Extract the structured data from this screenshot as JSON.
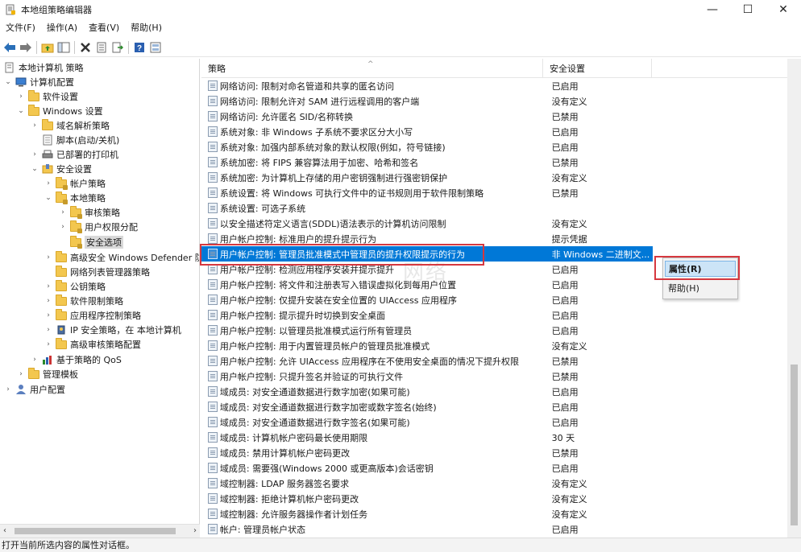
{
  "window": {
    "title": "本地组策略编辑器",
    "app_icon": "policy-editor-icon",
    "minimize": "—",
    "maximize": "☐",
    "close": "✕"
  },
  "menu": [
    "文件(F)",
    "操作(A)",
    "查看(V)",
    "帮助(H)"
  ],
  "toolbar": [
    "back-arrow-icon",
    "forward-arrow-icon",
    "up-folder-icon",
    "show-tree-icon",
    "delete-icon",
    "properties-icon",
    "export-icon",
    "help-icon",
    "view-icon"
  ],
  "tree": [
    {
      "label": "本地计算机 策略",
      "level": 0,
      "chev": "",
      "icon": "computer-policy-icon"
    },
    {
      "label": "计算机配置",
      "level": 1,
      "chev": "v",
      "icon": "computer-icon"
    },
    {
      "label": "软件设置",
      "level": 2,
      "chev": ">",
      "icon": "folder-icon"
    },
    {
      "label": "Windows 设置",
      "level": 2,
      "chev": "v",
      "icon": "folder-icon"
    },
    {
      "label": "域名解析策略",
      "level": 3,
      "chev": ">",
      "icon": "folder-icon"
    },
    {
      "label": "脚本(启动/关机)",
      "level": 3,
      "chev": "",
      "icon": "script-icon"
    },
    {
      "label": "已部署的打印机",
      "level": 3,
      "chev": ">",
      "icon": "printer-icon"
    },
    {
      "label": "安全设置",
      "level": 3,
      "chev": "v",
      "icon": "security-icon"
    },
    {
      "label": "帐户策略",
      "level": 4,
      "chev": ">",
      "icon": "lock-folder-icon"
    },
    {
      "label": "本地策略",
      "level": 4,
      "chev": "v",
      "icon": "lock-folder-icon"
    },
    {
      "label": "审核策略",
      "level": 5,
      "chev": ">",
      "icon": "lock-folder-icon"
    },
    {
      "label": "用户权限分配",
      "level": 5,
      "chev": ">",
      "icon": "lock-folder-icon"
    },
    {
      "label": "安全选项",
      "level": 5,
      "chev": "",
      "icon": "lock-folder-icon",
      "selected": true
    },
    {
      "label": "高级安全 Windows Defender 防",
      "level": 4,
      "chev": ">",
      "icon": "folder-icon"
    },
    {
      "label": "网络列表管理器策略",
      "level": 4,
      "chev": "",
      "icon": "folder-icon"
    },
    {
      "label": "公钥策略",
      "level": 4,
      "chev": ">",
      "icon": "folder-icon"
    },
    {
      "label": "软件限制策略",
      "level": 4,
      "chev": ">",
      "icon": "folder-icon"
    },
    {
      "label": "应用程序控制策略",
      "level": 4,
      "chev": ">",
      "icon": "folder-icon"
    },
    {
      "label": "IP 安全策略，在 本地计算机",
      "level": 4,
      "chev": ">",
      "icon": "ip-security-icon"
    },
    {
      "label": "高级审核策略配置",
      "level": 4,
      "chev": ">",
      "icon": "folder-icon"
    },
    {
      "label": "基于策略的 QoS",
      "level": 3,
      "chev": ">",
      "icon": "chart-icon"
    },
    {
      "label": "管理模板",
      "level": 2,
      "chev": ">",
      "icon": "folder-icon"
    },
    {
      "label": "用户配置",
      "level": 1,
      "chev": ">",
      "icon": "user-icon"
    }
  ],
  "list": {
    "col_policy": "策略",
    "col_setting": "安全设置",
    "rows": [
      {
        "name": "网络访问: 限制对命名管道和共享的匿名访问",
        "setting": "已启用"
      },
      {
        "name": "网络访问: 限制允许对 SAM 进行远程调用的客户端",
        "setting": "没有定义"
      },
      {
        "name": "网络访问: 允许匿名 SID/名称转换",
        "setting": "已禁用"
      },
      {
        "name": "系统对象: 非 Windows 子系统不要求区分大小写",
        "setting": "已启用"
      },
      {
        "name": "系统对象: 加强内部系统对象的默认权限(例如，符号链接)",
        "setting": "已启用"
      },
      {
        "name": "系统加密: 将 FIPS 兼容算法用于加密、哈希和签名",
        "setting": "已禁用"
      },
      {
        "name": "系统加密: 为计算机上存储的用户密钥强制进行强密钥保护",
        "setting": "没有定义"
      },
      {
        "name": "系统设置: 将 Windows 可执行文件中的证书规则用于软件限制策略",
        "setting": "已禁用"
      },
      {
        "name": "系统设置: 可选子系统",
        "setting": ""
      },
      {
        "name": "以安全描述符定义语言(SDDL)语法表示的计算机访问限制",
        "setting": "没有定义"
      },
      {
        "name": "用户帐户控制: 标准用户的提升提示行为",
        "setting": "提示凭据"
      },
      {
        "name": "用户帐户控制: 管理员批准模式中管理员的提升权限提示的行为",
        "setting": "非 Windows 二进制文...",
        "selected": true
      },
      {
        "name": "用户帐户控制: 检测应用程序安装并提示提升",
        "setting": "已启用"
      },
      {
        "name": "用户帐户控制: 将文件和注册表写入错误虚拟化到每用户位置",
        "setting": "已启用"
      },
      {
        "name": "用户帐户控制: 仅提升安装在安全位置的 UIAccess 应用程序",
        "setting": "已启用"
      },
      {
        "name": "用户帐户控制: 提示提升时切换到安全桌面",
        "setting": "已启用"
      },
      {
        "name": "用户帐户控制: 以管理员批准模式运行所有管理员",
        "setting": "已启用"
      },
      {
        "name": "用户帐户控制: 用于内置管理员帐户的管理员批准模式",
        "setting": "没有定义"
      },
      {
        "name": "用户帐户控制: 允许 UIAccess 应用程序在不使用安全桌面的情况下提升权限",
        "setting": "已禁用"
      },
      {
        "name": "用户帐户控制: 只提升签名并验证的可执行文件",
        "setting": "已禁用"
      },
      {
        "name": "域成员: 对安全通道数据进行数字加密(如果可能)",
        "setting": "已启用"
      },
      {
        "name": "域成员: 对安全通道数据进行数字加密或数字签名(始终)",
        "setting": "已启用"
      },
      {
        "name": "域成员: 对安全通道数据进行数字签名(如果可能)",
        "setting": "已启用"
      },
      {
        "name": "域成员: 计算机帐户密码最长使用期限",
        "setting": "30 天"
      },
      {
        "name": "域成员: 禁用计算机帐户密码更改",
        "setting": "已禁用"
      },
      {
        "name": "域成员: 需要强(Windows 2000 或更高版本)会话密钥",
        "setting": "已启用"
      },
      {
        "name": "域控制器: LDAP 服务器签名要求",
        "setting": "没有定义"
      },
      {
        "name": "域控制器: 拒绝计算机帐户密码更改",
        "setting": "没有定义"
      },
      {
        "name": "域控制器: 允许服务器操作者计划任务",
        "setting": "没有定义"
      },
      {
        "name": "帐户: 管理员帐户状态",
        "setting": "已启用"
      }
    ]
  },
  "watermark": "网络",
  "context_menu": {
    "properties": "属性(R)",
    "help": "帮助(H)"
  },
  "status": "打开当前所选内容的属性对话框。",
  "colors": {
    "selection": "#0078d7",
    "highlight_box": "#d6383f",
    "folder": "#f3c74f"
  }
}
